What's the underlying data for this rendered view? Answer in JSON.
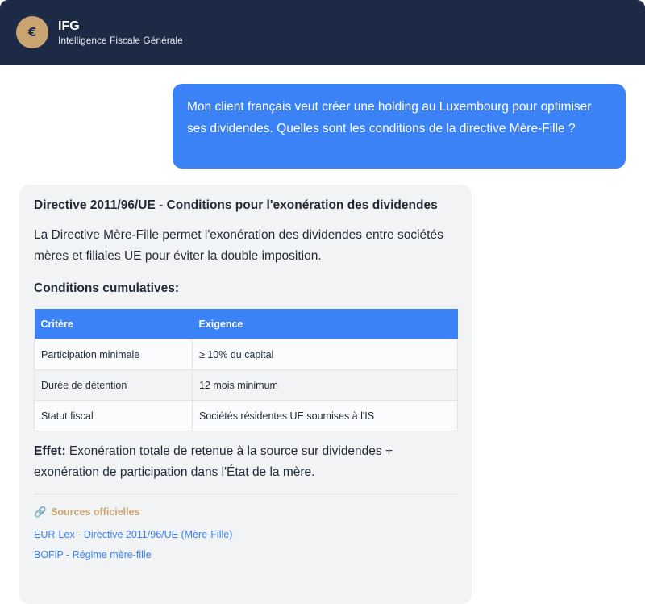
{
  "header": {
    "logo_symbol": "€",
    "title": "IFG",
    "subtitle": "Intelligence Fiscale Générale"
  },
  "user_message": {
    "text": "Mon client français veut créer une holding au Luxembourg pour optimiser ses dividendes. Quelles sont les conditions de la directive Mère-Fille ?"
  },
  "assistant_message": {
    "title": "Directive 2011/96/UE - Conditions pour l'exonération des dividendes",
    "intro": "La Directive Mère-Fille permet l'exonération des dividendes entre sociétés mères et filiales UE pour éviter la double imposition.",
    "conditions_title": "Conditions cumulatives:",
    "table": {
      "headers": [
        "Critère",
        "Exigence"
      ],
      "rows": [
        [
          "Participation minimale",
          "≥ 10% du capital"
        ],
        [
          "Durée de détention",
          "12 mois minimum"
        ],
        [
          "Statut fiscal",
          "Sociétés résidentes UE soumises à l'IS"
        ]
      ]
    },
    "effect_label": "Effet:",
    "effect_text": " Exonération totale de retenue à la source sur dividendes + exonération de participation dans l'État de la mère.",
    "sources": {
      "icon": "link-icon",
      "icon_glyph": "🔗",
      "title": "Sources officielles",
      "links": [
        "EUR-Lex - Directive 2011/96/UE (Mère-Fille)",
        "BOFiP - Régime mère-fille"
      ]
    }
  },
  "colors": {
    "header_bg": "#1c2a45",
    "accent_gold": "#c9a470",
    "user_bubble": "#3b82f6",
    "assistant_bubble": "#f2f3f5"
  }
}
